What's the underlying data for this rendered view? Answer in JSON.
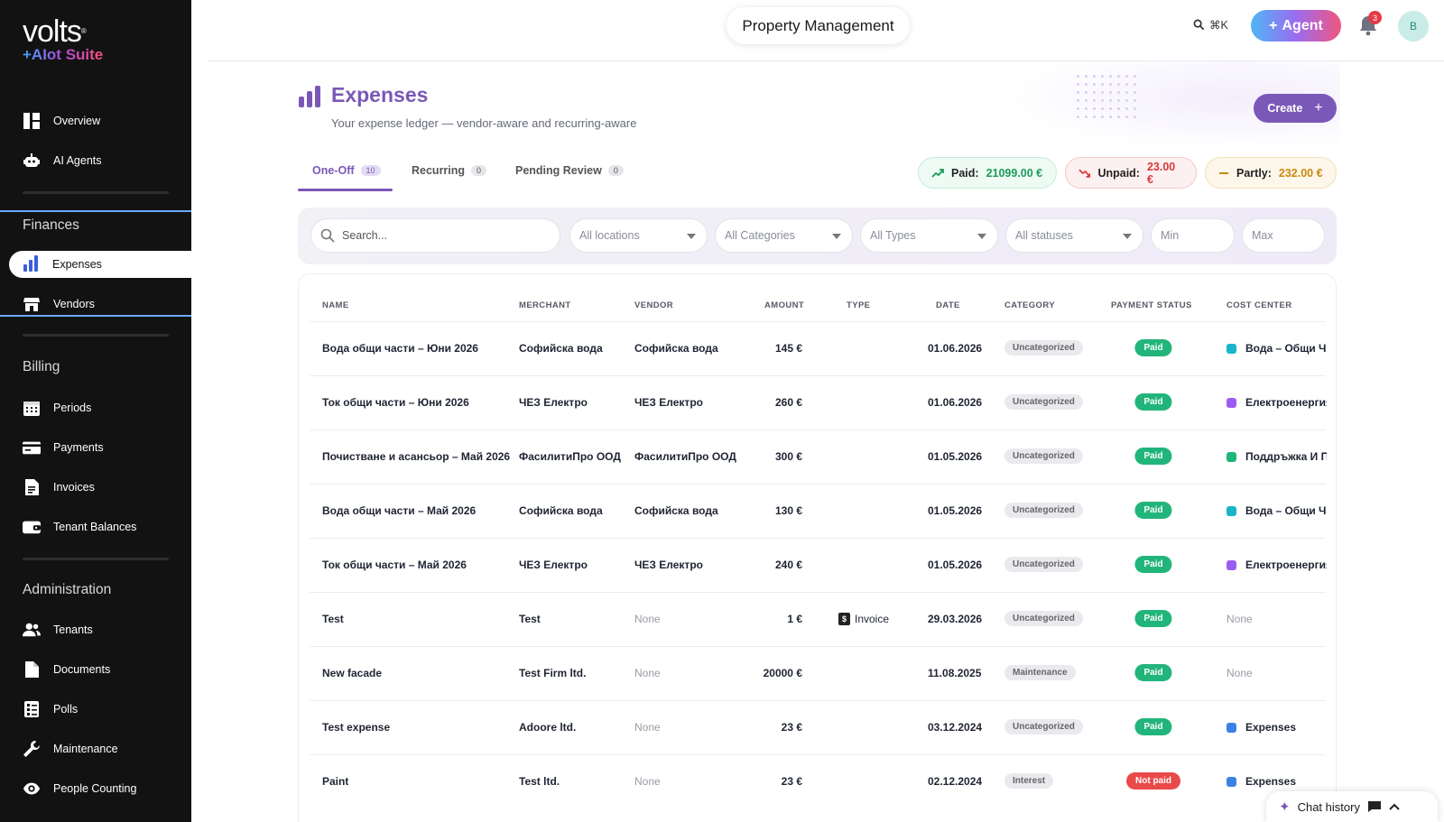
{
  "brand": {
    "name": "volts",
    "suite": "+AIot Suite"
  },
  "sidebar": {
    "top_items": [
      {
        "label": "Overview",
        "icon": "dashboard-icon"
      },
      {
        "label": "AI Agents",
        "icon": "robot-icon"
      }
    ],
    "finances": {
      "title": "Finances",
      "items": [
        {
          "label": "Expenses",
          "icon": "bar-chart-icon",
          "active": true
        },
        {
          "label": "Vendors",
          "icon": "store-icon"
        }
      ]
    },
    "billing": {
      "title": "Billing",
      "items": [
        {
          "label": "Periods",
          "icon": "calendar-icon"
        },
        {
          "label": "Payments",
          "icon": "credit-card-icon"
        },
        {
          "label": "Invoices",
          "icon": "document-icon"
        },
        {
          "label": "Tenant Balances",
          "icon": "wallet-icon"
        }
      ]
    },
    "administration": {
      "title": "Administration",
      "items": [
        {
          "label": "Tenants",
          "icon": "people-icon"
        },
        {
          "label": "Documents",
          "icon": "file-icon"
        },
        {
          "label": "Polls",
          "icon": "checklist-icon"
        },
        {
          "label": "Maintenance",
          "icon": "wrench-icon"
        },
        {
          "label": "People Counting",
          "icon": "eye-icon"
        }
      ]
    }
  },
  "header": {
    "title": "Property Management",
    "shortcut": "⌘K",
    "agent_label": "Agent",
    "notification_count": "3",
    "avatar_initial": "B"
  },
  "page": {
    "title": "Expenses",
    "subtitle": "Your expense ledger — vendor-aware and recurring-aware",
    "create_label": "Create"
  },
  "tabs": [
    {
      "label": "One-Off",
      "count": "10",
      "active": true
    },
    {
      "label": "Recurring",
      "count": "0"
    },
    {
      "label": "Pending Review",
      "count": "0"
    }
  ],
  "summary": {
    "paid_label": "Paid:",
    "paid_value": "21099.00 €",
    "unpaid_label": "Unpaid:",
    "unpaid_value": "23.00 €",
    "partly_label": "Partly:",
    "partly_value": "232.00 €"
  },
  "filters": {
    "search_placeholder": "Search...",
    "locations": "All locations",
    "categories": "All Categories",
    "types": "All Types",
    "statuses": "All statuses",
    "min_placeholder": "Min",
    "max_placeholder": "Max"
  },
  "table": {
    "headers": [
      "NAME",
      "MERCHANT",
      "VENDOR",
      "AMOUNT",
      "TYPE",
      "DATE",
      "CATEGORY",
      "PAYMENT STATUS",
      "COST CENTER"
    ],
    "rows": [
      {
        "name": "Вода общи части – Юни 2026",
        "merchant": "Софийска вода",
        "vendor": "Софийска вода",
        "amount": "145 €",
        "type": "",
        "date": "01.06.2026",
        "category": "Uncategorized",
        "status": "Paid",
        "cost_center": "Вода – Общи Ча",
        "cc_color": "#19b5c9"
      },
      {
        "name": "Ток общи части – Юни 2026",
        "merchant": "ЧЕЗ Електро",
        "vendor": "ЧЕЗ Електро",
        "amount": "260 €",
        "type": "",
        "date": "01.06.2026",
        "category": "Uncategorized",
        "status": "Paid",
        "cost_center": "Електроенергия",
        "cc_color": "#9b5cf0"
      },
      {
        "name": "Почистване и асансьор – Май 2026",
        "merchant": "ФасилитиПро ООД",
        "vendor": "ФасилитиПро ООД",
        "amount": "300 €",
        "type": "",
        "date": "01.05.2026",
        "category": "Uncategorized",
        "status": "Paid",
        "cost_center": "Поддръжка И П",
        "cc_color": "#22b57a"
      },
      {
        "name": "Вода общи части – Май 2026",
        "merchant": "Софийска вода",
        "vendor": "Софийска вода",
        "amount": "130 €",
        "type": "",
        "date": "01.05.2026",
        "category": "Uncategorized",
        "status": "Paid",
        "cost_center": "Вода – Общи Ча",
        "cc_color": "#19b5c9"
      },
      {
        "name": "Ток общи части – Май 2026",
        "merchant": "ЧЕЗ Електро",
        "vendor": "ЧЕЗ Електро",
        "amount": "240 €",
        "type": "",
        "date": "01.05.2026",
        "category": "Uncategorized",
        "status": "Paid",
        "cost_center": "Електроенергия",
        "cc_color": "#9b5cf0"
      },
      {
        "name": "Test",
        "merchant": "Test",
        "vendor": "None",
        "amount": "1 €",
        "type": "Invoice",
        "date": "29.03.2026",
        "category": "Uncategorized",
        "status": "Paid",
        "cost_center": "None",
        "cc_color": ""
      },
      {
        "name": "New facade",
        "merchant": "Test Firm ltd.",
        "vendor": "None",
        "amount": "20000 €",
        "type": "",
        "date": "11.08.2025",
        "category": "Maintenance",
        "status": "Paid",
        "cost_center": "None",
        "cc_color": ""
      },
      {
        "name": "Test expense",
        "merchant": "Adoore ltd.",
        "vendor": "None",
        "amount": "23 €",
        "type": "",
        "date": "03.12.2024",
        "category": "Uncategorized",
        "status": "Paid",
        "cost_center": "Expenses",
        "cc_color": "#3b82e6"
      },
      {
        "name": "Paint",
        "merchant": "Test ltd.",
        "vendor": "None",
        "amount": "23 €",
        "type": "",
        "date": "02.12.2024",
        "category": "Interest",
        "status": "Not paid",
        "cost_center": "Expenses",
        "cc_color": "#3b82e6"
      }
    ]
  },
  "colors": {
    "accent": "#7a58b8",
    "paid": "#22b57a",
    "not_paid": "#e84a4a"
  },
  "chat": {
    "label": "Chat history"
  }
}
